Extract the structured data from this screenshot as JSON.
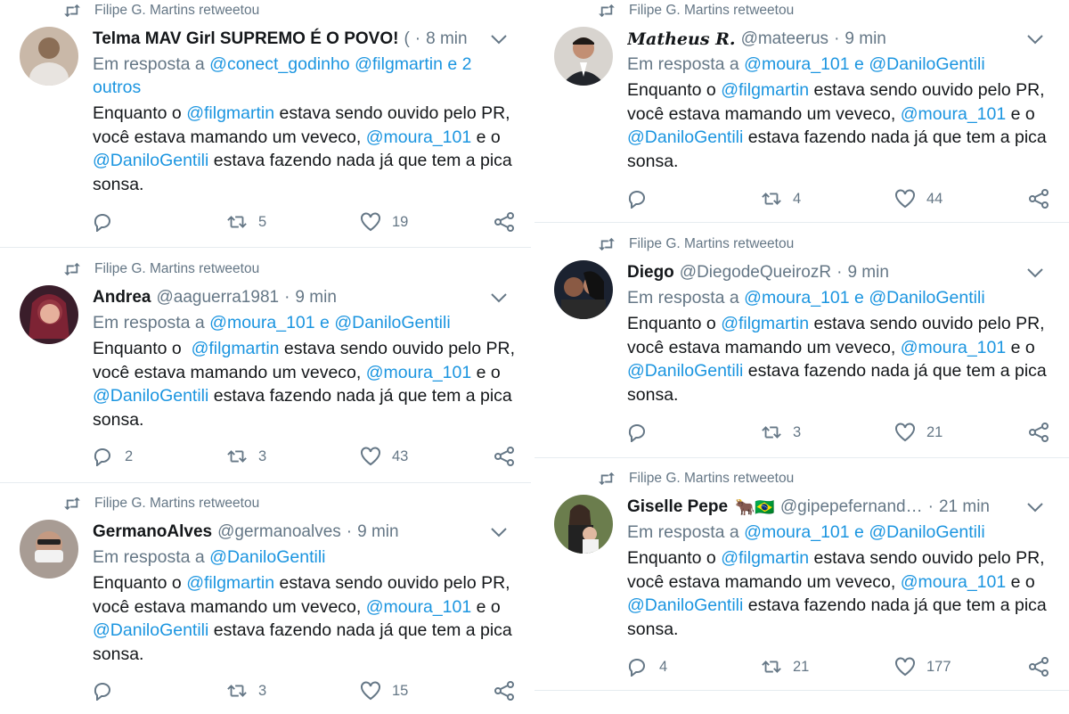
{
  "retweet_label": "Filipe G. Martins retweetou",
  "colors": {
    "link": "#1b95e0",
    "muted": "#657786",
    "text": "#14171a",
    "divider": "#e6ecf0"
  },
  "left": [
    {
      "name": "Telma MAV Girl SUPREMO É O POVO!",
      "handle": "(",
      "dot": "·",
      "time": "8 min",
      "reply_prefix": "Em resposta a",
      "reply_mentions": [
        "@conect_godinho",
        "@filgmartin"
      ],
      "reply_suffix": "e 2 outros",
      "text": [
        "Enquanto o ",
        "@filgmartin",
        " estava sendo ouvido pelo PR, você estava mamando um veveco, ",
        "@moura_101",
        " e o ",
        "@DaniloGentili",
        " estava fazendo nada já que tem a pica sonsa."
      ],
      "replies": "",
      "retweets": "5",
      "likes": "19",
      "avatar_color": "#b59a86"
    },
    {
      "name": "Andrea",
      "handle": "@aaguerra1981",
      "dot": "·",
      "time": "9 min",
      "reply_prefix": "Em resposta a",
      "reply_mentions": [
        "@moura_101",
        "@DaniloGentili"
      ],
      "reply_joiner": "e",
      "text": [
        "Enquanto o  ",
        "@filgmartin",
        " estava sendo ouvido pelo PR, você estava mamando um veveco, ",
        "@moura_101",
        " e o ",
        "@DaniloGentili",
        " estava fazendo nada já que tem a pica sonsa."
      ],
      "replies": "2",
      "retweets": "3",
      "likes": "43",
      "avatar_color": "#7a2a3c"
    },
    {
      "name": "GermanoAlves",
      "handle": "@germanoalves",
      "dot": "·",
      "time": "9 min",
      "reply_prefix": "Em resposta a",
      "reply_mentions": [
        "@DaniloGentili"
      ],
      "text": [
        "Enquanto o ",
        "@filgmartin",
        " estava sendo ouvido pelo PR, você estava mamando um veveco, ",
        "@moura_101",
        " e o ",
        "@DaniloGentili",
        " estava fazendo nada já que tem a pica sonsa."
      ],
      "replies": "",
      "retweets": "3",
      "likes": "15",
      "avatar_color": "#8c7f78"
    }
  ],
  "right": [
    {
      "name": "Matheus R.",
      "handle": "@mateerus",
      "dot": "·",
      "time": "9 min",
      "reply_prefix": "Em resposta a",
      "reply_mentions": [
        "@moura_101",
        "@DaniloGentili"
      ],
      "reply_joiner": "e",
      "text": [
        "Enquanto o ",
        "@filgmartin",
        " estava sendo ouvido pelo PR, você estava mamando um veveco, ",
        "@moura_101",
        " e o ",
        "@DaniloGentili",
        " estava fazendo nada já que tem a pica sonsa."
      ],
      "replies": "",
      "retweets": "4",
      "likes": "44",
      "avatar_color": "#3a3d44"
    },
    {
      "name": "Diego",
      "handle": "@DiegodeQueirozR",
      "dot": "·",
      "time": "9 min",
      "reply_prefix": "Em resposta a",
      "reply_mentions": [
        "@moura_101",
        "@DaniloGentili"
      ],
      "reply_joiner": "e",
      "text": [
        "Enquanto o ",
        "@filgmartin",
        " estava sendo ouvido pelo PR, você estava mamando um veveco, ",
        "@moura_101",
        " e o ",
        "@DaniloGentili",
        " estava fazendo nada já que tem a pica sonsa."
      ],
      "replies": "",
      "retweets": "3",
      "likes": "21",
      "avatar_color": "#2c2a35"
    },
    {
      "name": "Giselle Pepe",
      "name_emoji": "🐂🇧🇷",
      "handle": "@gipepefernand…",
      "dot": "·",
      "time": "21 min",
      "reply_prefix": "Em resposta a",
      "reply_mentions": [
        "@moura_101",
        "@DaniloGentili"
      ],
      "reply_joiner": "e",
      "text": [
        "Enquanto o ",
        "@filgmartin",
        " estava sendo ouvido pelo PR, você estava mamando um veveco, ",
        "@moura_101",
        " e o ",
        "@DaniloGentili",
        " estava fazendo nada já que tem a pica sonsa."
      ],
      "replies": "4",
      "retweets": "21",
      "likes": "177",
      "avatar_color": "#4e5d3c"
    }
  ]
}
